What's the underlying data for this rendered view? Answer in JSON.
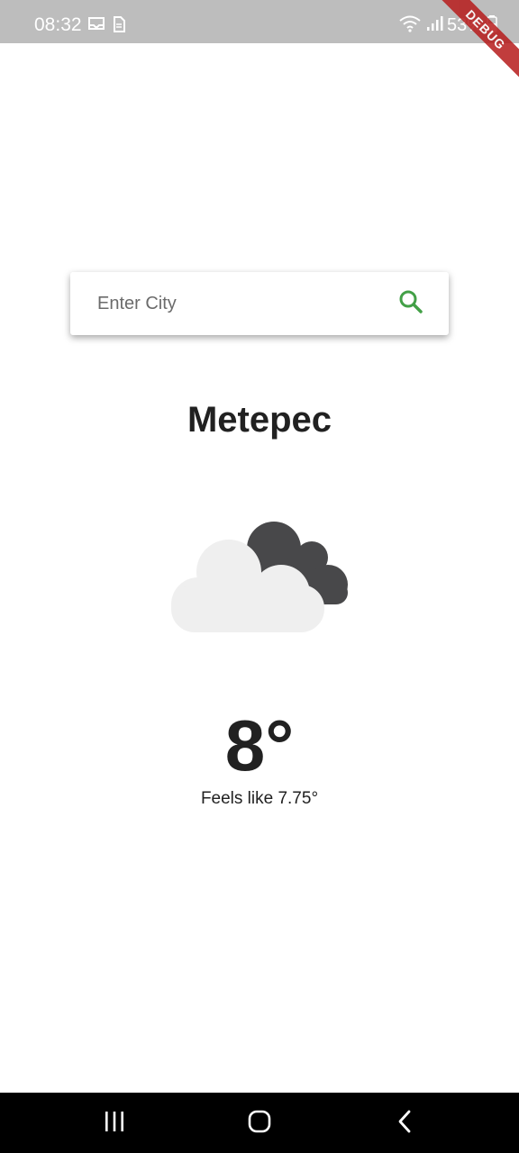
{
  "status_bar": {
    "time": "08:32",
    "battery": "53%",
    "left_icons": [
      "tray-icon",
      "sim-icon"
    ],
    "right_icons": [
      "wifi-icon",
      "signal-icon",
      "battery-icon"
    ]
  },
  "debug_banner": {
    "label": "DEBUG",
    "color": "#b71c1c"
  },
  "search": {
    "placeholder": "Enter City",
    "value": "",
    "icon": "search-icon",
    "icon_color": "#43a047"
  },
  "weather": {
    "city": "Metepec",
    "icon": "cloudy-night-icon",
    "temperature": "8°",
    "feels_like": "Feels like 7.75°"
  },
  "nav_bar": {
    "buttons": [
      "recent-apps-icon",
      "home-icon",
      "back-icon"
    ]
  }
}
